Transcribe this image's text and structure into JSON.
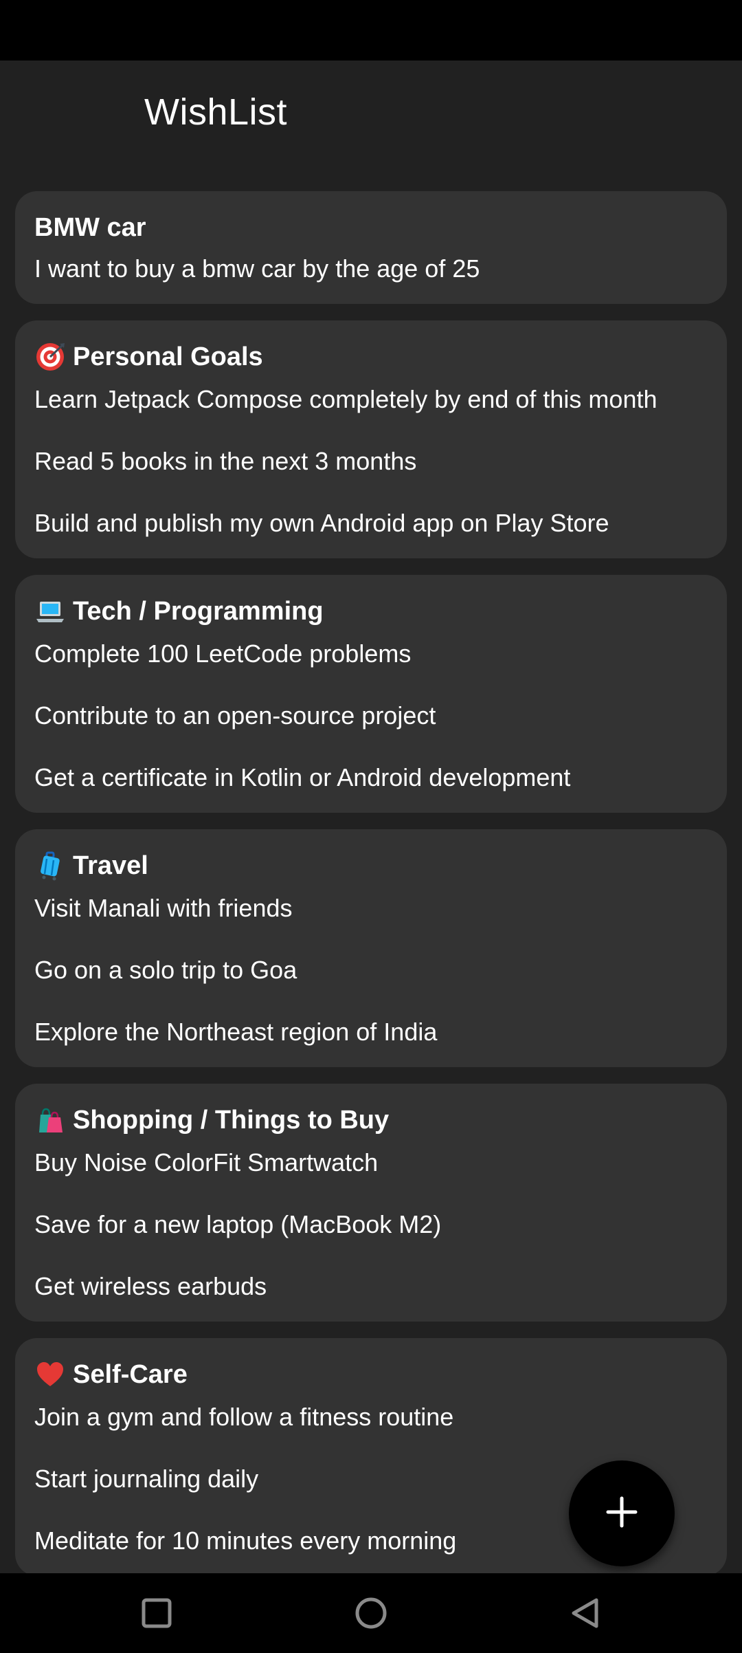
{
  "app": {
    "title": "WishList"
  },
  "cards": [
    {
      "title": "BMW car",
      "icon": "",
      "items": [
        "I want to buy a bmw car by the age of 25"
      ]
    },
    {
      "title": "Personal Goals",
      "icon": "target-icon",
      "items": [
        "Learn Jetpack Compose completely by end of this month",
        "Read 5 books in the next 3 months",
        "Build and publish my own Android app on Play Store"
      ]
    },
    {
      "title": "Tech / Programming",
      "icon": "laptop-icon",
      "items": [
        "Complete 100 LeetCode problems",
        "Contribute to an open-source project",
        "Get a certificate in Kotlin or Android development"
      ]
    },
    {
      "title": "Travel",
      "icon": "suitcase-icon",
      "items": [
        "Visit Manali with friends",
        "Go on a solo trip to Goa",
        "Explore the Northeast region of India"
      ]
    },
    {
      "title": "Shopping / Things to Buy",
      "icon": "shopping-bags-icon",
      "items": [
        "Buy Noise ColorFit Smartwatch",
        "Save for a new laptop (MacBook M2)",
        "Get wireless earbuds"
      ]
    },
    {
      "title": "Self-Care",
      "icon": "heart-icon",
      "items": [
        "Join a gym and follow a fitness routine",
        "Start journaling daily",
        "Meditate for 10 minutes every morning"
      ]
    }
  ],
  "fab": {
    "icon": "plus-icon"
  },
  "navigation": {
    "recents_icon": "square-icon",
    "home_icon": "circle-icon",
    "back_icon": "triangle-back-icon"
  },
  "colors": {
    "background": "#212121",
    "card": "#333333",
    "text": "#ffffff",
    "fab": "#000000",
    "system_bars": "#000000"
  }
}
